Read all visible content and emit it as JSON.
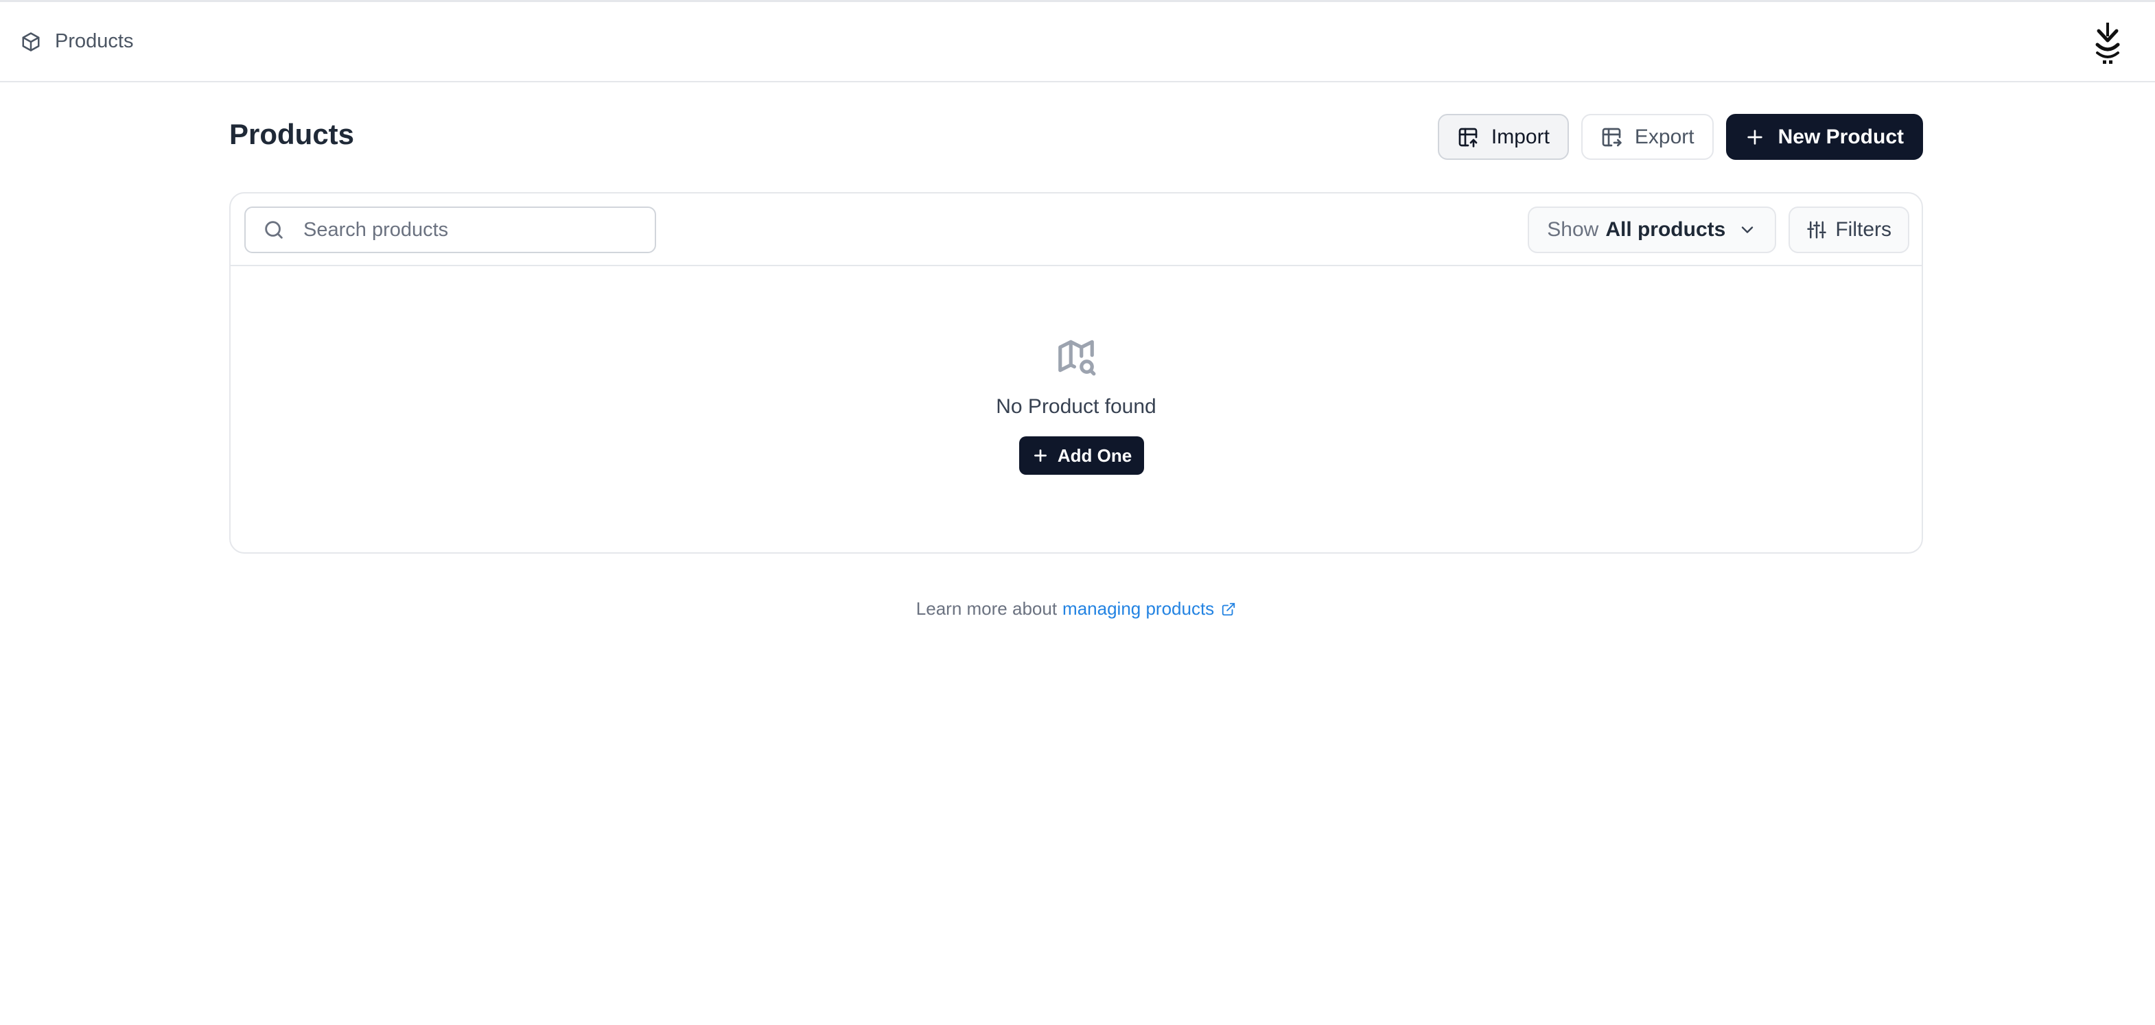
{
  "topbar": {
    "breadcrumb_icon": "cube-icon",
    "breadcrumb_label": "Products",
    "logo_icon": "app-logo-icon"
  },
  "page": {
    "title": "Products"
  },
  "actions": {
    "import_label": "Import",
    "export_label": "Export",
    "new_product_label": "New Product"
  },
  "toolbar": {
    "search_placeholder": "Search products",
    "search_value": "",
    "show_prefix": "Show",
    "show_value": "All products",
    "filters_label": "Filters"
  },
  "empty_state": {
    "icon": "map-search-icon",
    "message": "No Product found",
    "add_label": "Add One"
  },
  "footer": {
    "learn_prefix": "Learn more about",
    "learn_link": "managing products"
  },
  "colors": {
    "primary": "#0f172a",
    "link": "#2383e2",
    "border": "#e5e7eb"
  }
}
